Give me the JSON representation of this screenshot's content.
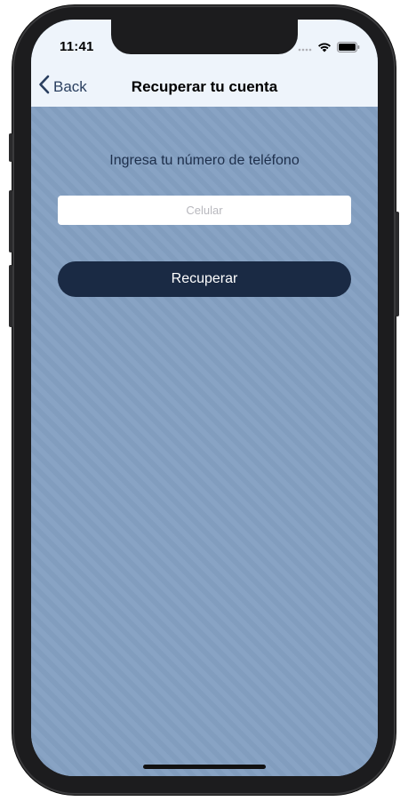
{
  "status_bar": {
    "time": "11:41",
    "icons": [
      "cellular-dots-icon",
      "wifi-icon",
      "battery-icon"
    ]
  },
  "nav": {
    "back_label": "Back",
    "title": "Recuperar tu cuenta"
  },
  "form": {
    "prompt": "Ingresa tu número de teléfono",
    "phone_placeholder": "Celular",
    "phone_value": "",
    "submit_label": "Recuperar"
  },
  "colors": {
    "background": "#84a0c2",
    "navbar": "#eef4fb",
    "button": "#1a2a44",
    "accent_text": "#2a3f5f"
  }
}
